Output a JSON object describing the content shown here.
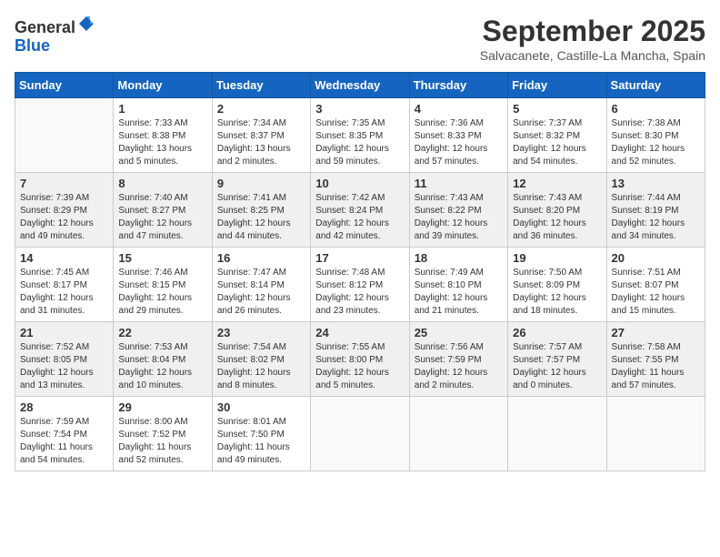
{
  "logo": {
    "general": "General",
    "blue": "Blue"
  },
  "header": {
    "month": "September 2025",
    "location": "Salvacanete, Castille-La Mancha, Spain"
  },
  "weekdays": [
    "Sunday",
    "Monday",
    "Tuesday",
    "Wednesday",
    "Thursday",
    "Friday",
    "Saturday"
  ],
  "weeks": [
    [
      {
        "day": "",
        "info": ""
      },
      {
        "day": "1",
        "info": "Sunrise: 7:33 AM\nSunset: 8:38 PM\nDaylight: 13 hours\nand 5 minutes."
      },
      {
        "day": "2",
        "info": "Sunrise: 7:34 AM\nSunset: 8:37 PM\nDaylight: 13 hours\nand 2 minutes."
      },
      {
        "day": "3",
        "info": "Sunrise: 7:35 AM\nSunset: 8:35 PM\nDaylight: 12 hours\nand 59 minutes."
      },
      {
        "day": "4",
        "info": "Sunrise: 7:36 AM\nSunset: 8:33 PM\nDaylight: 12 hours\nand 57 minutes."
      },
      {
        "day": "5",
        "info": "Sunrise: 7:37 AM\nSunset: 8:32 PM\nDaylight: 12 hours\nand 54 minutes."
      },
      {
        "day": "6",
        "info": "Sunrise: 7:38 AM\nSunset: 8:30 PM\nDaylight: 12 hours\nand 52 minutes."
      }
    ],
    [
      {
        "day": "7",
        "info": "Sunrise: 7:39 AM\nSunset: 8:29 PM\nDaylight: 12 hours\nand 49 minutes."
      },
      {
        "day": "8",
        "info": "Sunrise: 7:40 AM\nSunset: 8:27 PM\nDaylight: 12 hours\nand 47 minutes."
      },
      {
        "day": "9",
        "info": "Sunrise: 7:41 AM\nSunset: 8:25 PM\nDaylight: 12 hours\nand 44 minutes."
      },
      {
        "day": "10",
        "info": "Sunrise: 7:42 AM\nSunset: 8:24 PM\nDaylight: 12 hours\nand 42 minutes."
      },
      {
        "day": "11",
        "info": "Sunrise: 7:43 AM\nSunset: 8:22 PM\nDaylight: 12 hours\nand 39 minutes."
      },
      {
        "day": "12",
        "info": "Sunrise: 7:43 AM\nSunset: 8:20 PM\nDaylight: 12 hours\nand 36 minutes."
      },
      {
        "day": "13",
        "info": "Sunrise: 7:44 AM\nSunset: 8:19 PM\nDaylight: 12 hours\nand 34 minutes."
      }
    ],
    [
      {
        "day": "14",
        "info": "Sunrise: 7:45 AM\nSunset: 8:17 PM\nDaylight: 12 hours\nand 31 minutes."
      },
      {
        "day": "15",
        "info": "Sunrise: 7:46 AM\nSunset: 8:15 PM\nDaylight: 12 hours\nand 29 minutes."
      },
      {
        "day": "16",
        "info": "Sunrise: 7:47 AM\nSunset: 8:14 PM\nDaylight: 12 hours\nand 26 minutes."
      },
      {
        "day": "17",
        "info": "Sunrise: 7:48 AM\nSunset: 8:12 PM\nDaylight: 12 hours\nand 23 minutes."
      },
      {
        "day": "18",
        "info": "Sunrise: 7:49 AM\nSunset: 8:10 PM\nDaylight: 12 hours\nand 21 minutes."
      },
      {
        "day": "19",
        "info": "Sunrise: 7:50 AM\nSunset: 8:09 PM\nDaylight: 12 hours\nand 18 minutes."
      },
      {
        "day": "20",
        "info": "Sunrise: 7:51 AM\nSunset: 8:07 PM\nDaylight: 12 hours\nand 15 minutes."
      }
    ],
    [
      {
        "day": "21",
        "info": "Sunrise: 7:52 AM\nSunset: 8:05 PM\nDaylight: 12 hours\nand 13 minutes."
      },
      {
        "day": "22",
        "info": "Sunrise: 7:53 AM\nSunset: 8:04 PM\nDaylight: 12 hours\nand 10 minutes."
      },
      {
        "day": "23",
        "info": "Sunrise: 7:54 AM\nSunset: 8:02 PM\nDaylight: 12 hours\nand 8 minutes."
      },
      {
        "day": "24",
        "info": "Sunrise: 7:55 AM\nSunset: 8:00 PM\nDaylight: 12 hours\nand 5 minutes."
      },
      {
        "day": "25",
        "info": "Sunrise: 7:56 AM\nSunset: 7:59 PM\nDaylight: 12 hours\nand 2 minutes."
      },
      {
        "day": "26",
        "info": "Sunrise: 7:57 AM\nSunset: 7:57 PM\nDaylight: 12 hours\nand 0 minutes."
      },
      {
        "day": "27",
        "info": "Sunrise: 7:58 AM\nSunset: 7:55 PM\nDaylight: 11 hours\nand 57 minutes."
      }
    ],
    [
      {
        "day": "28",
        "info": "Sunrise: 7:59 AM\nSunset: 7:54 PM\nDaylight: 11 hours\nand 54 minutes."
      },
      {
        "day": "29",
        "info": "Sunrise: 8:00 AM\nSunset: 7:52 PM\nDaylight: 11 hours\nand 52 minutes."
      },
      {
        "day": "30",
        "info": "Sunrise: 8:01 AM\nSunset: 7:50 PM\nDaylight: 11 hours\nand 49 minutes."
      },
      {
        "day": "",
        "info": ""
      },
      {
        "day": "",
        "info": ""
      },
      {
        "day": "",
        "info": ""
      },
      {
        "day": "",
        "info": ""
      }
    ]
  ]
}
